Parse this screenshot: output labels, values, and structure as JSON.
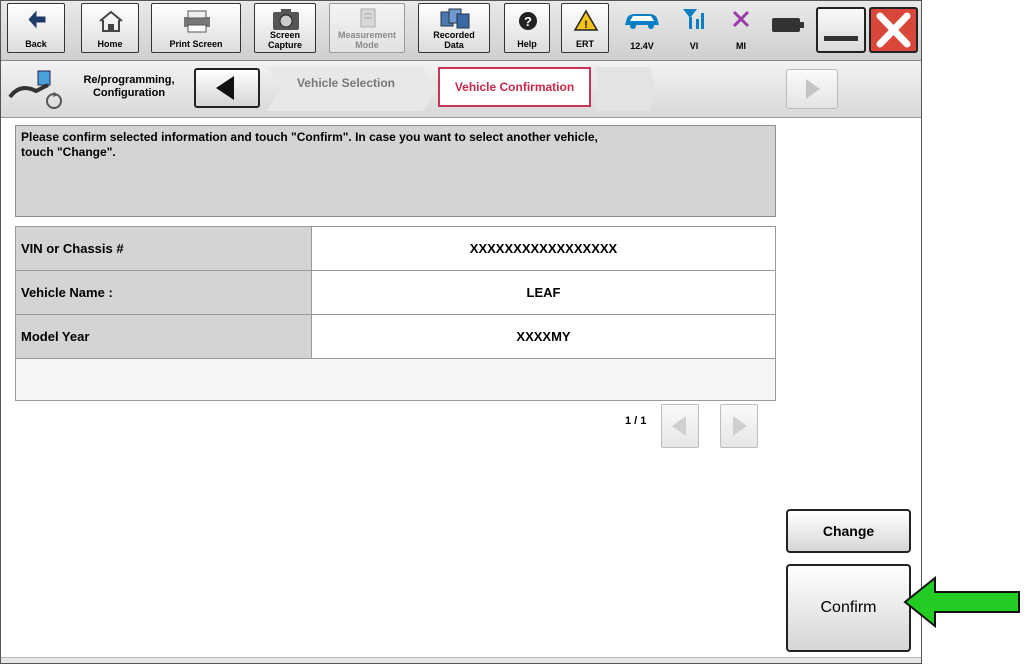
{
  "toolbar": {
    "buttons": [
      {
        "label": "Back",
        "icon": "back-arrow-icon"
      },
      {
        "label": "Home",
        "icon": "home-icon"
      },
      {
        "label": "Print Screen",
        "icon": "printer-icon"
      },
      {
        "label": "Screen",
        "label2": "Capture",
        "icon": "camera-icon"
      },
      {
        "label": "Measurement",
        "label2": "Mode",
        "icon": "measurement-icon",
        "disabled": true
      },
      {
        "label": "Recorded",
        "label2": "Data",
        "icon": "recorded-data-icon"
      },
      {
        "label": "Help",
        "icon": "help-icon"
      },
      {
        "label": "ERT",
        "icon": "warning-icon"
      }
    ],
    "status": {
      "battery_label": "12.4V",
      "vi_label": "VI",
      "mi_label": "MI"
    }
  },
  "nav": {
    "section_label_line1": "Re/programming,",
    "section_label_line2": "Configuration",
    "steps": [
      "Vehicle Selection",
      "Vehicle Confirmation"
    ],
    "active_step": "Vehicle Confirmation"
  },
  "message": {
    "line1": "Please confirm selected information and touch \"Confirm\". In case you want to select another vehicle,",
    "line2": "touch \"Change\"."
  },
  "table": {
    "rows": [
      {
        "key": "VIN or Chassis #",
        "value": "XXXXXXXXXXXXXXXXX"
      },
      {
        "key": "Vehicle Name :",
        "value": "LEAF"
      },
      {
        "key": "Model Year",
        "value": "XXXXMY"
      }
    ]
  },
  "pager": {
    "text": "1 / 1"
  },
  "buttons": {
    "change": "Change",
    "confirm": "Confirm"
  },
  "colors": {
    "active_step": "#c8284f",
    "callout_arrow": "#22cc22",
    "close_button": "#d9463a"
  }
}
